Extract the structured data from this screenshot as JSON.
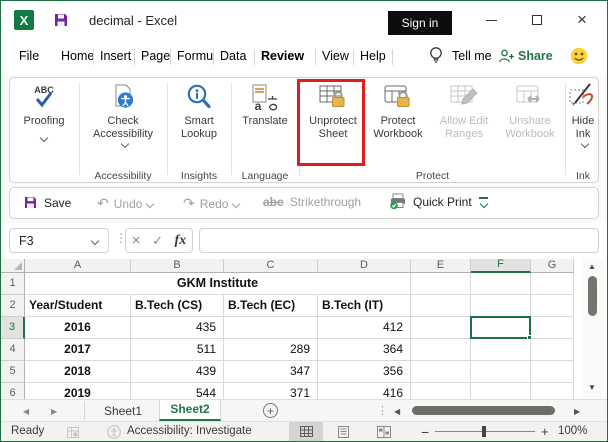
{
  "titlebar": {
    "app_title": "decimal - Excel",
    "sign_in": "Sign in"
  },
  "menu": {
    "tabs": [
      "File",
      "Home",
      "Insert",
      "Page",
      "Formu",
      "Data",
      "Review",
      "View",
      "Help"
    ],
    "active_tab": "Review",
    "tell_me": "Tell me",
    "share": "Share"
  },
  "ribbon": {
    "buttons": {
      "proofing": "Proofing",
      "check_accessibility": "Check Accessibility",
      "smart_lookup": "Smart Lookup",
      "translate": "Translate",
      "unprotect_sheet": "Unprotect Sheet",
      "protect_workbook": "Protect Workbook",
      "allow_edit_ranges": "Allow Edit Ranges",
      "unshare_workbook": "Unshare Workbook",
      "hide_ink": "Hide Ink"
    },
    "groups": {
      "accessibility": "Accessibility",
      "insights": "Insights",
      "language": "Language",
      "protect": "Protect",
      "ink": "Ink"
    }
  },
  "qat": {
    "save": "Save",
    "undo": "Undo",
    "redo": "Redo",
    "strike_abc": "abc",
    "strikethrough": "Strikethrough",
    "quick_print": "Quick Print"
  },
  "formula_bar": {
    "name_box": "F3",
    "cancel": "×",
    "enter": "✓",
    "fx_label": "fx",
    "formula": ""
  },
  "grid": {
    "column_headers": [
      "A",
      "B",
      "C",
      "D",
      "E",
      "F",
      "G"
    ],
    "row_headers": [
      "1",
      "2",
      "3",
      "4",
      "5",
      "6"
    ],
    "selected_cell": "F3",
    "selected_column": "F",
    "selected_row": "3",
    "title_cell": "GKM Institute",
    "header_cells": [
      "Year/Student",
      "B.Tech (CS)",
      "B.Tech (EC)",
      "B.Tech (IT)"
    ],
    "rows": [
      [
        "2016",
        "435",
        "",
        "412"
      ],
      [
        "2017",
        "511",
        "289",
        "364"
      ],
      [
        "2018",
        "439",
        "347",
        "356"
      ],
      [
        "2019",
        "544",
        "371",
        "416"
      ]
    ]
  },
  "sheet_tabs": {
    "sheets": [
      "Sheet1",
      "Sheet2"
    ],
    "active_sheet": "Sheet2"
  },
  "status_bar": {
    "mode": "Ready",
    "accessibility": "Accessibility: Investigate",
    "zoom_level": "100%"
  },
  "colors": {
    "excel_green": "#217346",
    "selection_green": "#1e7145",
    "highlight_red": "#e11d1d",
    "save_purple": "#7723a5",
    "lock_gold": "#e8b54d",
    "disabled_gray": "#bdbbb9"
  }
}
